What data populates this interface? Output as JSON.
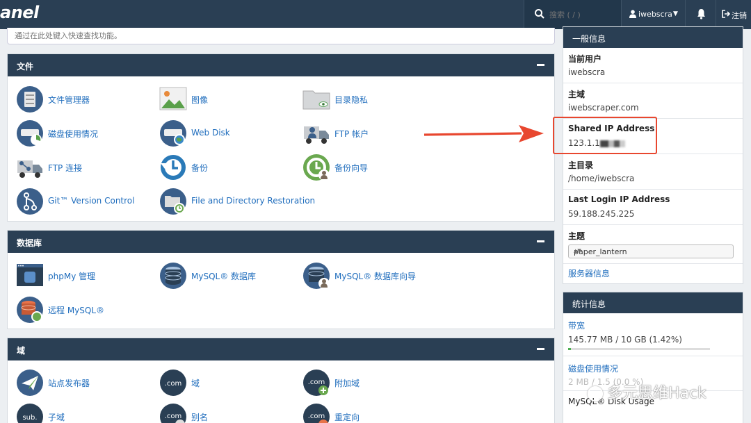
{
  "topbar": {
    "logo": "anel",
    "search_placeholder": "搜索 ( / )",
    "username": "iwebscra",
    "logout_label": "注销"
  },
  "quick_search": {
    "placeholder": "通过在此处键入快速查找功能。"
  },
  "panels": {
    "files": {
      "title": "文件",
      "items": [
        "文件管理器",
        "图像",
        "目录隐私",
        "磁盘使用情况",
        "Web Disk",
        "FTP 帐户",
        "FTP 连接",
        "备份",
        "备份向导",
        "Git™ Version Control",
        "File and Directory Restoration"
      ]
    },
    "databases": {
      "title": "数据库",
      "items": [
        "phpMy 管理",
        "MySQL® 数据库",
        "MySQL® 数据库向导",
        "远程 MySQL®"
      ]
    },
    "domains": {
      "title": "域",
      "items": [
        "站点发布器",
        "域",
        "附加域",
        "子域",
        "别名",
        "重定向"
      ]
    }
  },
  "general_info": {
    "title": "一般信息",
    "current_user_label": "当前用户",
    "current_user": "iwebscra",
    "primary_domain_label": "主域",
    "primary_domain": "iwebscraper.com",
    "shared_ip_label": "Shared IP Address",
    "shared_ip_visible": "123.1.1",
    "home_dir_label": "主目录",
    "home_dir": "/home/iwebscra",
    "last_login_label": "Last Login IP Address",
    "last_login": "59.188.245.225",
    "theme_label": "主题",
    "theme_value": "paper_lantern",
    "server_info_link": "服务器信息"
  },
  "stats": {
    "title": "统计信息",
    "bandwidth_label": "带宽",
    "bandwidth_value": "145.77 MB / 10 GB   (1.42%)",
    "bandwidth_fraction": 0.0142,
    "disk_label": "磁盘使用情况",
    "disk_value": "2  MB / 1.5  (0.0  %)",
    "mysql_label": "MySQL® Disk Usage"
  },
  "watermark": "多元思维Hack",
  "colors": {
    "header": "#2a3f54",
    "link": "#1f6dbd",
    "annotation": "#e8472f"
  }
}
